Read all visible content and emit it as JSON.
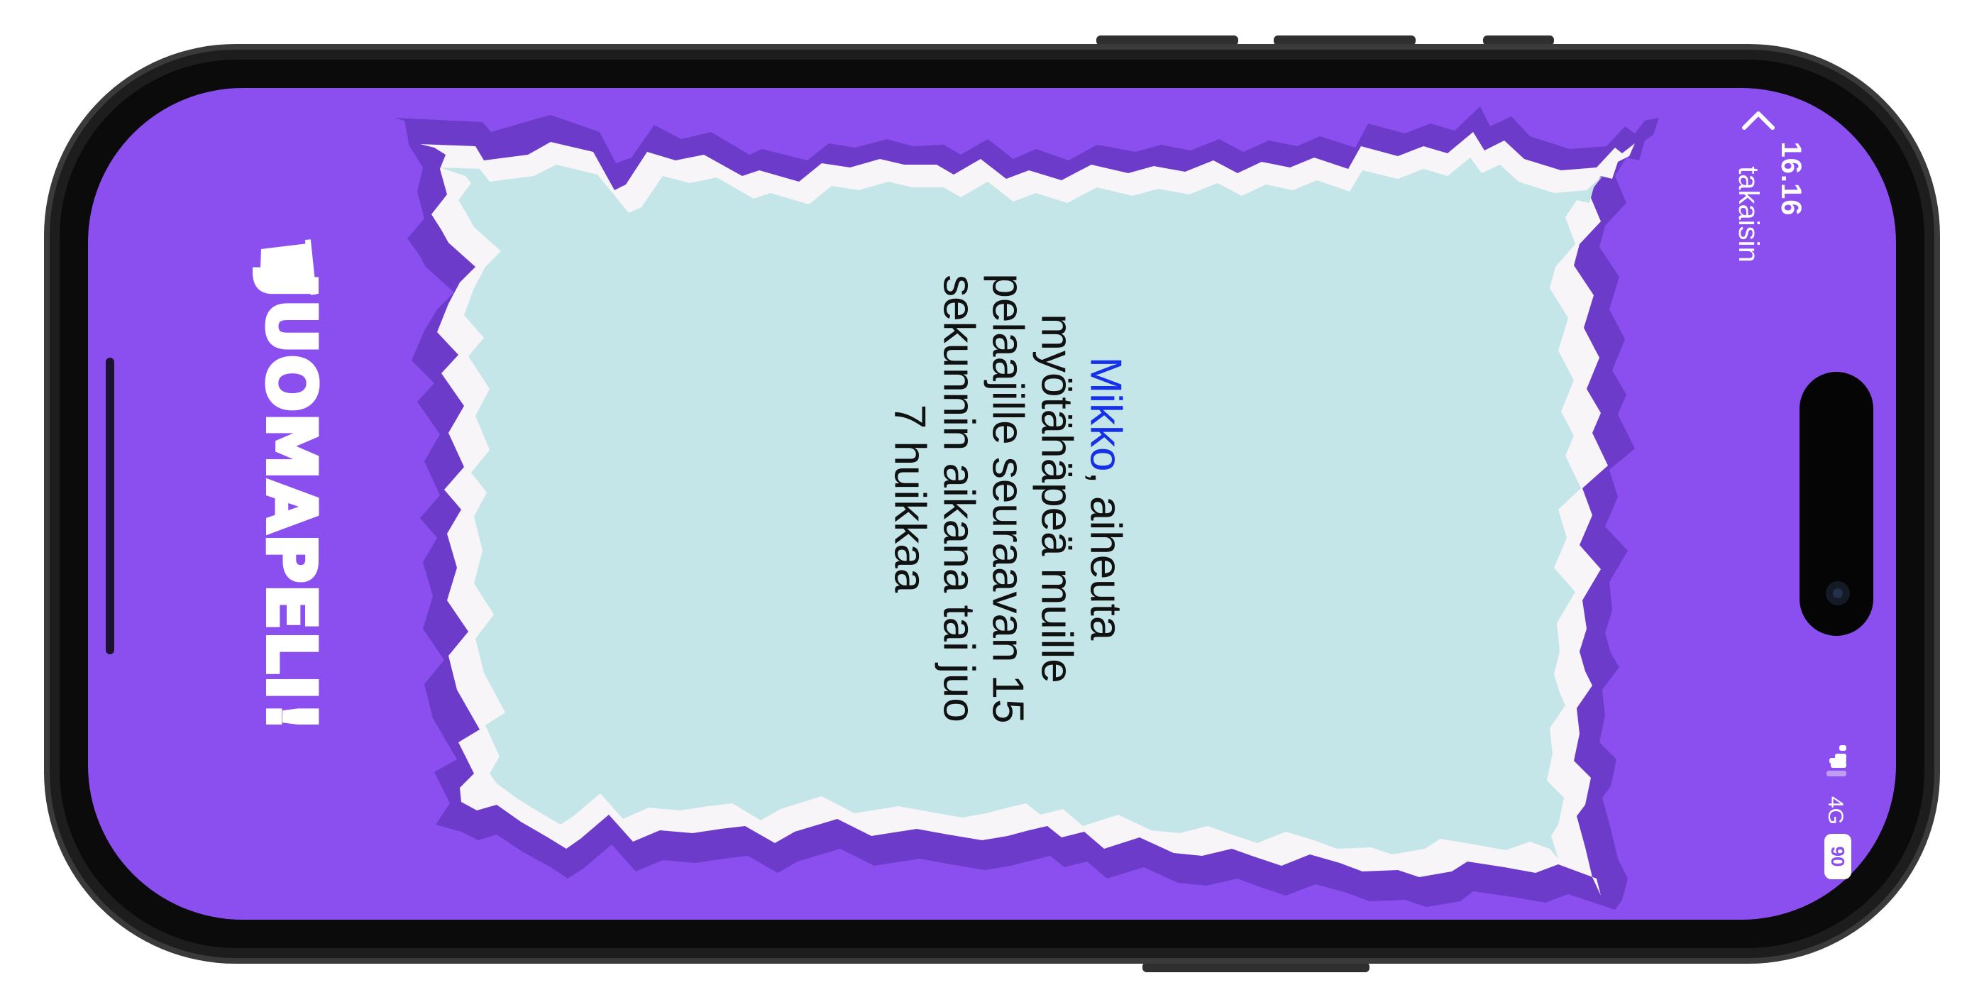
{
  "status_bar": {
    "time": "16.16",
    "network": "4G",
    "battery": "90"
  },
  "nav": {
    "back_label": "takaisin"
  },
  "logo": {
    "text": "JUOMAPELI!"
  },
  "card": {
    "player_name": "Mikko",
    "lines": [
      ", aiheuta",
      "myötähäpeä muille",
      "pelaajille seuraavan 15",
      "sekunnin aikana tai juo",
      "7 huikkaa"
    ]
  },
  "colors": {
    "background": "#8b4ff0",
    "card_shadow": "#6c3bc9",
    "card_border": "#f7f5f7",
    "card_fill": "#c4e6e8",
    "player_name": "#1630e8",
    "device_frame": "#2b2b2b"
  },
  "icons": {
    "back": "chevron-left-icon",
    "signal": "signal-bars-icon",
    "battery": "battery-icon",
    "logo_cup": "cup-icon"
  }
}
